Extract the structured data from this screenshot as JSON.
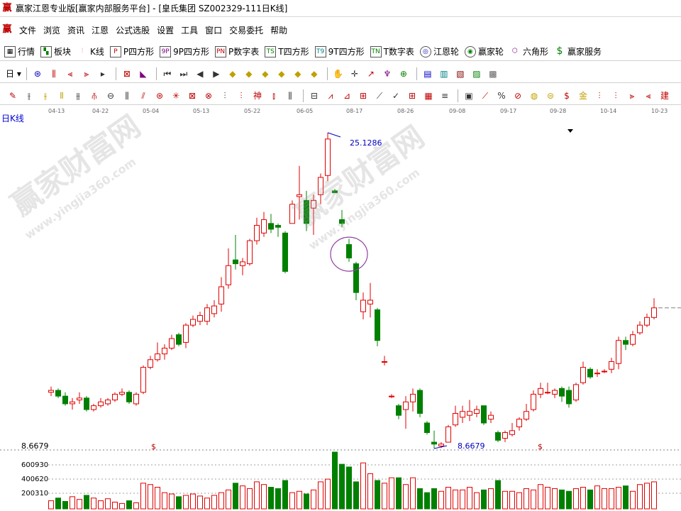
{
  "window": {
    "title": "赢家江恩专业版[赢家内部服务平台] - [皇氏集团  SZ002329-111日K线]"
  },
  "menu": [
    "文件",
    "浏览",
    "资讯",
    "江恩",
    "公式选股",
    "设置",
    "工具",
    "窗口",
    "交易委托",
    "帮助"
  ],
  "toolbar1": [
    {
      "label": "行情",
      "icon": "grid-icon"
    },
    {
      "label": "板块",
      "icon": "blocks-icon"
    },
    {
      "label": "K线",
      "icon": "kline-icon"
    },
    {
      "label": "P四方形",
      "icon": "P"
    },
    {
      "label": "9P四方形",
      "icon": "9P"
    },
    {
      "label": "P数字表",
      "icon": "PN"
    },
    {
      "label": "T四方形",
      "icon": "TS"
    },
    {
      "label": "9T四方形",
      "icon": "T9"
    },
    {
      "label": "T数字表",
      "icon": "TN"
    },
    {
      "label": "江恩轮",
      "icon": "wheel-icon"
    },
    {
      "label": "赢家轮",
      "icon": "wheel-icon"
    },
    {
      "label": "六角形",
      "icon": "hexagon-icon"
    },
    {
      "label": "赢家服务",
      "icon": "dollar-icon"
    }
  ],
  "period_selector": "日",
  "period_label": "日K线",
  "date_ticks": [
    "04-13",
    "04-22",
    "05-04",
    "05-13",
    "05-22",
    "06-05",
    "08-17",
    "08-26",
    "09-08",
    "09-17",
    "09-28",
    "10-14",
    "10-23"
  ],
  "price_labels": {
    "high": "25.1286",
    "low": "8.6679",
    "axis_low": "8.6679"
  },
  "volume_labels": [
    "600930",
    "400620",
    "200310"
  ],
  "watermark": {
    "cn": "赢家财富网",
    "url": "www.yingjia360.com"
  },
  "colors": {
    "up": "#e00000",
    "down": "#008000",
    "label": "#0000c0",
    "highlight": "#9040a0"
  },
  "chart_data": {
    "type": "candlestick",
    "ylim": [
      8.6679,
      25.1286
    ],
    "candles": [
      {
        "o": 11.6,
        "c": 11.7,
        "h": 11.9,
        "l": 11.4
      },
      {
        "o": 11.7,
        "c": 11.4,
        "h": 11.8,
        "l": 11.3
      },
      {
        "o": 11.4,
        "c": 11.0,
        "h": 11.6,
        "l": 10.9
      },
      {
        "o": 11.0,
        "c": 11.1,
        "h": 11.3,
        "l": 10.7
      },
      {
        "o": 11.2,
        "c": 11.3,
        "h": 11.6,
        "l": 11.0
      },
      {
        "o": 11.3,
        "c": 10.7,
        "h": 11.4,
        "l": 10.6
      },
      {
        "o": 10.7,
        "c": 10.9,
        "h": 11.0,
        "l": 10.6
      },
      {
        "o": 10.9,
        "c": 11.1,
        "h": 11.3,
        "l": 10.8
      },
      {
        "o": 11.0,
        "c": 11.2,
        "h": 11.3,
        "l": 10.9
      },
      {
        "o": 11.2,
        "c": 11.5,
        "h": 11.6,
        "l": 11.1
      },
      {
        "o": 11.5,
        "c": 11.6,
        "h": 11.8,
        "l": 11.4
      },
      {
        "o": 11.6,
        "c": 11.1,
        "h": 11.7,
        "l": 11.0
      },
      {
        "o": 11.0,
        "c": 11.5,
        "h": 11.6,
        "l": 10.9
      },
      {
        "o": 11.6,
        "c": 12.9,
        "h": 13.0,
        "l": 11.5
      },
      {
        "o": 12.9,
        "c": 13.3,
        "h": 13.5,
        "l": 12.8
      },
      {
        "o": 13.3,
        "c": 13.6,
        "h": 14.2,
        "l": 13.2
      },
      {
        "o": 13.6,
        "c": 13.9,
        "h": 14.1,
        "l": 13.3
      },
      {
        "o": 13.9,
        "c": 14.4,
        "h": 14.6,
        "l": 13.8
      },
      {
        "o": 14.6,
        "c": 14.1,
        "h": 14.7,
        "l": 14.0
      },
      {
        "o": 14.2,
        "c": 15.1,
        "h": 15.2,
        "l": 13.9
      },
      {
        "o": 15.1,
        "c": 15.4,
        "h": 15.6,
        "l": 15.0
      },
      {
        "o": 15.3,
        "c": 15.6,
        "h": 15.8,
        "l": 15.1
      },
      {
        "o": 15.3,
        "c": 16.0,
        "h": 16.2,
        "l": 15.1
      },
      {
        "o": 15.7,
        "c": 16.1,
        "h": 16.4,
        "l": 15.5
      },
      {
        "o": 16.2,
        "c": 17.1,
        "h": 17.6,
        "l": 15.8
      },
      {
        "o": 17.2,
        "c": 18.2,
        "h": 19.1,
        "l": 17.0
      },
      {
        "o": 18.5,
        "c": 18.3,
        "h": 19.8,
        "l": 18.0
      },
      {
        "o": 18.2,
        "c": 18.4,
        "h": 18.6,
        "l": 17.7
      },
      {
        "o": 18.3,
        "c": 19.5,
        "h": 19.6,
        "l": 18.2
      },
      {
        "o": 19.5,
        "c": 20.3,
        "h": 20.7,
        "l": 19.3
      },
      {
        "o": 19.9,
        "c": 20.6,
        "h": 21.0,
        "l": 19.7
      },
      {
        "o": 20.4,
        "c": 20.1,
        "h": 20.9,
        "l": 19.9
      },
      {
        "o": 20.3,
        "c": 20.2,
        "h": 20.4,
        "l": 19.7
      },
      {
        "o": 19.9,
        "c": 17.9,
        "h": 20.0,
        "l": 17.8
      },
      {
        "o": 20.4,
        "c": 21.4,
        "h": 21.6,
        "l": 20.4
      },
      {
        "o": 21.8,
        "c": 21.9,
        "h": 23.4,
        "l": 20.6
      },
      {
        "o": 21.6,
        "c": 20.4,
        "h": 22.1,
        "l": 20.0
      },
      {
        "o": 21.2,
        "c": 21.6,
        "h": 21.9,
        "l": 19.8
      },
      {
        "o": 21.9,
        "c": 22.8,
        "h": 23.0,
        "l": 21.4
      },
      {
        "o": 22.9,
        "c": 24.8,
        "h": 25.1286,
        "l": 22.6
      },
      {
        "o": 22.1,
        "c": 22.0,
        "h": 22.2,
        "l": 22.0
      },
      {
        "o": 20.6,
        "c": 20.4,
        "h": 21.1,
        "l": 20.2
      },
      {
        "o": 19.3,
        "c": 18.6,
        "h": 19.6,
        "l": 18.4
      },
      {
        "o": 18.3,
        "c": 16.8,
        "h": 18.4,
        "l": 16.4
      },
      {
        "o": 15.8,
        "c": 16.4,
        "h": 16.8,
        "l": 15.4
      },
      {
        "o": 16.2,
        "c": 16.4,
        "h": 17.3,
        "l": 15.5
      },
      {
        "o": 15.9,
        "c": 14.3,
        "h": 16.0,
        "l": 14.0
      },
      {
        "o": 13.2,
        "c": 13.2,
        "h": 13.5,
        "l": 13.0
      },
      {
        "o": 11.4,
        "c": 11.4,
        "h": 11.5,
        "l": 11.3
      },
      {
        "o": 10.9,
        "c": 10.4,
        "h": 11.0,
        "l": 10.2
      },
      {
        "o": 10.7,
        "c": 11.1,
        "h": 11.4,
        "l": 9.7
      },
      {
        "o": 11.1,
        "c": 11.5,
        "h": 11.8,
        "l": 10.6
      },
      {
        "o": 11.7,
        "c": 10.5,
        "h": 11.8,
        "l": 10.3
      },
      {
        "o": 10.0,
        "c": 9.5,
        "h": 10.1,
        "l": 9.4
      },
      {
        "o": 9.0,
        "c": 8.9,
        "h": 9.6,
        "l": 8.6679
      },
      {
        "o": 8.8,
        "c": 8.9,
        "h": 9.0,
        "l": 8.7
      },
      {
        "o": 9.0,
        "c": 9.8,
        "h": 9.9,
        "l": 9.0
      },
      {
        "o": 9.9,
        "c": 10.5,
        "h": 10.9,
        "l": 9.8
      },
      {
        "o": 10.3,
        "c": 10.6,
        "h": 10.9,
        "l": 10.0
      },
      {
        "o": 10.4,
        "c": 10.6,
        "h": 11.2,
        "l": 10.1
      },
      {
        "o": 10.5,
        "c": 10.7,
        "h": 10.9,
        "l": 10.3
      },
      {
        "o": 10.9,
        "c": 10.0,
        "h": 10.9,
        "l": 9.9
      },
      {
        "o": 10.2,
        "c": 10.4,
        "h": 10.6,
        "l": 10.0
      },
      {
        "o": 9.5,
        "c": 9.1,
        "h": 9.6,
        "l": 9.0
      },
      {
        "o": 9.2,
        "c": 9.5,
        "h": 9.6,
        "l": 9.0
      },
      {
        "o": 9.4,
        "c": 9.6,
        "h": 10.0,
        "l": 9.3
      },
      {
        "o": 9.8,
        "c": 10.2,
        "h": 10.3,
        "l": 9.6
      },
      {
        "o": 10.2,
        "c": 10.6,
        "h": 11.0,
        "l": 10.1
      },
      {
        "o": 10.7,
        "c": 11.5,
        "h": 11.7,
        "l": 10.6
      },
      {
        "o": 11.5,
        "c": 11.8,
        "h": 12.1,
        "l": 11.3
      },
      {
        "o": 11.6,
        "c": 11.6,
        "h": 12.1,
        "l": 11.5
      },
      {
        "o": 11.5,
        "c": 11.7,
        "h": 11.8,
        "l": 11.3
      },
      {
        "o": 11.8,
        "c": 11.4,
        "h": 11.9,
        "l": 11.1
      },
      {
        "o": 11.7,
        "c": 11.0,
        "h": 11.9,
        "l": 10.8
      },
      {
        "o": 11.2,
        "c": 12.0,
        "h": 12.1,
        "l": 11.1
      },
      {
        "o": 12.1,
        "c": 12.9,
        "h": 13.2,
        "l": 12.0
      },
      {
        "o": 12.8,
        "c": 12.4,
        "h": 12.9,
        "l": 12.3
      },
      {
        "o": 12.6,
        "c": 12.6,
        "h": 12.8,
        "l": 12.4
      },
      {
        "o": 12.7,
        "c": 12.7,
        "h": 12.8,
        "l": 12.6
      },
      {
        "o": 12.8,
        "c": 13.2,
        "h": 13.4,
        "l": 12.6
      },
      {
        "o": 13.1,
        "c": 14.3,
        "h": 14.5,
        "l": 12.8
      },
      {
        "o": 14.3,
        "c": 14.1,
        "h": 14.5,
        "l": 13.8
      },
      {
        "o": 14.1,
        "c": 14.6,
        "h": 14.8,
        "l": 14.0
      },
      {
        "o": 14.7,
        "c": 15.1,
        "h": 15.3,
        "l": 14.6
      },
      {
        "o": 15.1,
        "c": 15.5,
        "h": 15.7,
        "l": 15.0
      },
      {
        "o": 15.5,
        "c": 16.0,
        "h": 16.5,
        "l": 15.4
      }
    ],
    "volumes": [
      60,
      80,
      55,
      90,
      70,
      100,
      80,
      60,
      75,
      50,
      40,
      60,
      45,
      190,
      180,
      160,
      120,
      110,
      90,
      100,
      110,
      95,
      80,
      100,
      120,
      140,
      190,
      170,
      150,
      200,
      180,
      160,
      150,
      210,
      120,
      130,
      110,
      140,
      200,
      220,
      420,
      330,
      310,
      200,
      340,
      260,
      210,
      190,
      230,
      230,
      180,
      230,
      150,
      120,
      150,
      130,
      160,
      140,
      140,
      160,
      120,
      140,
      150,
      210,
      130,
      130,
      120,
      150,
      140,
      180,
      160,
      150,
      140,
      130,
      150,
      160,
      140,
      170,
      150,
      150,
      160,
      170,
      130,
      180,
      190,
      200
    ]
  }
}
